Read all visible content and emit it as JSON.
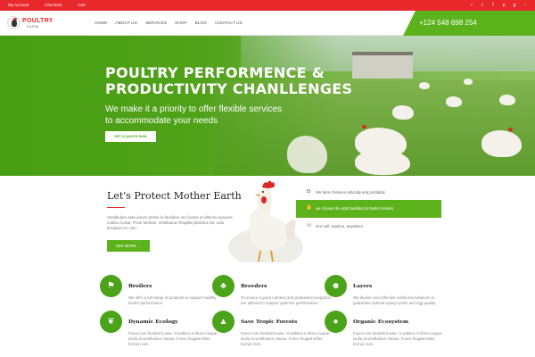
{
  "topbar": {
    "links": [
      "My Account",
      "Checkout",
      "Cart"
    ],
    "social": [
      "cart-icon",
      "twitter-icon",
      "facebook-icon",
      "pinterest-icon",
      "google-plus-icon",
      "instagram-icon"
    ]
  },
  "logo": {
    "name": "POULTRY",
    "sub": "FARM"
  },
  "nav": {
    "items": [
      "HOME",
      "ABOUT US",
      "SERVICES",
      "SHOP",
      "BLOG",
      "CONTACT US"
    ],
    "phone": "+124 548 698 254"
  },
  "hero": {
    "title": "POULTRY PERFORMENCE & PRODUCTIVITY CHANLLENGES",
    "subtitle": "We make it a priority to offer flexible services to accommodate your needs",
    "button": "GET A QUOTE NOW"
  },
  "about": {
    "title": "Let's Protect Mother Earth",
    "text": "Vestibulum ante ipsum primis in faucibus orci luctus et ultrices posuere cubilia Curae; Proin facilisis. Vestibulum fringilla pharetra est, odio tincidunt mi, non.",
    "button": "SEE MORE →"
  },
  "features": [
    {
      "label": "We farm chickens ethically and profitably",
      "icon": "leaf-icon",
      "active": false
    },
    {
      "label": "we choose the right bedding for better broilers",
      "icon": "hand-icon",
      "active": true
    },
    {
      "label": "Our call, anytime, anywhere",
      "icon": "phone-icon",
      "active": false
    }
  ],
  "colors": {
    "brand_red": "#e8282b",
    "brand_green": "#5cb21b"
  },
  "services": [
    {
      "title": "Broilers",
      "text": "We offer a full range of products to support healthy broiler performance.",
      "icon": "flag-icon"
    },
    {
      "title": "Breeders",
      "text": "To ensure a good nutrition and production programs are tailored to support optimum performance.",
      "icon": "tree-icon"
    },
    {
      "title": "Layers",
      "text": "We devise cost-effective nutritional solutions to guarantee optimal laying cycles and egg quality.",
      "icon": "people-icon"
    },
    {
      "title": "Dynamic Ecology",
      "text": "Fusce non hendrerit ante. Curabitur in libero neque. Nulla at vestibulum massa. Fusce feugiat tellus fermen tum.",
      "icon": "plant-icon"
    },
    {
      "title": "Save Tropic Forests",
      "text": "Fusce non hendrerit ante. Curabitur in libero neque. Nulla at vestibulum massa. Fusce feugiat tellus fermen tum.",
      "icon": "pine-tree-icon"
    },
    {
      "title": "Organic Ecosystem",
      "text": "Fusce non hendrerit ante. Curabitur in libero neque. Nulla at vestibulum massa. Fusce feugiat tellus fermen tum.",
      "icon": "drop-icon"
    }
  ]
}
